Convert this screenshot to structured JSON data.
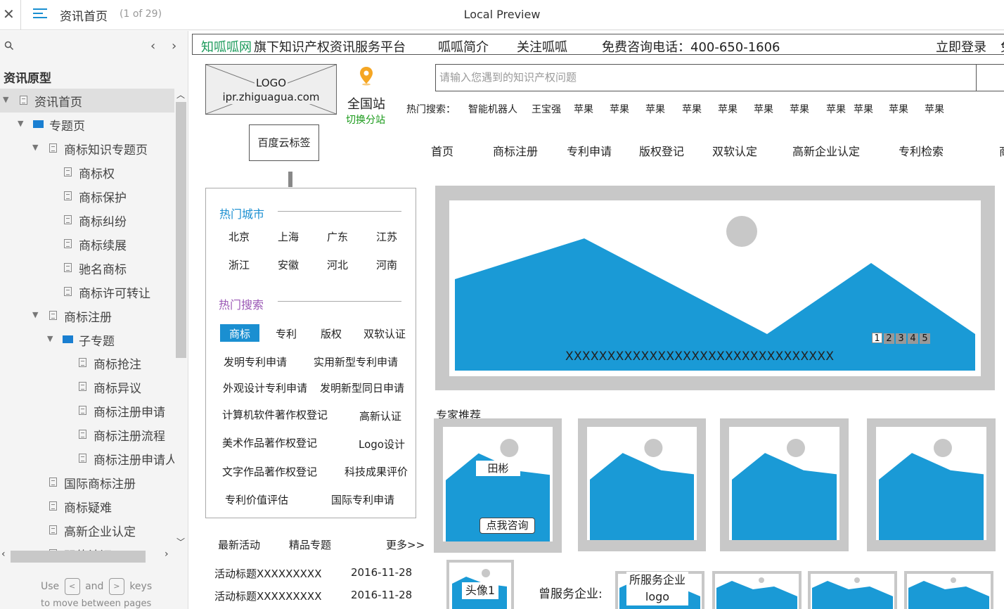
{
  "topbar": {
    "close_glyph": "✕",
    "page_title": "资讯首页",
    "page_count": "(1 of 29)",
    "preview_title": "Local Preview"
  },
  "sidebar": {
    "section_heading": "资讯原型",
    "items": [
      {
        "label": "资讯首页"
      },
      {
        "label": "专题页"
      },
      {
        "label": "商标知识专题页"
      },
      {
        "label": "商标权"
      },
      {
        "label": "商标保护"
      },
      {
        "label": "商标纠纷"
      },
      {
        "label": "商标续展"
      },
      {
        "label": "驰名商标"
      },
      {
        "label": "商标许可转让"
      },
      {
        "label": "商标注册"
      },
      {
        "label": "子专题"
      },
      {
        "label": "商标抢注"
      },
      {
        "label": "商标异议"
      },
      {
        "label": "商标注册申请"
      },
      {
        "label": "商标注册流程"
      },
      {
        "label": "商标注册申请人"
      },
      {
        "label": "国际商标注册"
      },
      {
        "label": "商标疑难"
      },
      {
        "label": "高新企业认定"
      },
      {
        "label": "双软认证"
      }
    ],
    "help": {
      "use": "Use",
      "and": "and",
      "keys": "keys",
      "prev_key": "<",
      "next_key": ">",
      "move_text": "to move between pages"
    }
  },
  "page": {
    "infobar": {
      "brand": "知呱呱网",
      "slogan": "旗下知识产权资讯服务平台",
      "about": "呱呱简介",
      "follow": "关注呱呱",
      "hotline": "免费咨询电话：400-650-1606",
      "login": "立即登录",
      "register_partial": "免"
    },
    "logo": {
      "line1": "LOGO",
      "line2": "ipr.zhiguagua.com"
    },
    "location": {
      "station": "全国站",
      "switch": "切换分站"
    },
    "baidu_tag": "百度云标签",
    "search": {
      "placeholder": "请输入您遇到的知识产权问题"
    },
    "hot_search": {
      "label": "热门搜索：",
      "items": [
        "智能机器人",
        "王宝强",
        "苹果",
        "苹果",
        "苹果",
        "苹果",
        "苹果",
        "苹果",
        "苹果",
        "苹果",
        "苹果",
        "苹果",
        "苹果"
      ]
    },
    "nav": [
      "首页",
      "商标注册",
      "专利申请",
      "版权登记",
      "双软认定",
      "高新企业认定",
      "专利检索",
      "商"
    ],
    "hot_cities": {
      "title": "热门城市",
      "cities": [
        "北京",
        "上海",
        "广东",
        "江苏",
        "浙江",
        "安徽",
        "河北",
        "河南"
      ]
    },
    "hot_searches": {
      "title": "热门搜索",
      "tags": [
        "商标",
        "专利",
        "版权",
        "双软认证"
      ],
      "links": [
        "发明专利申请",
        "实用新型专利申请",
        "外观设计专利申请",
        "发明新型同日申请",
        "计算机软件著作权登记",
        "高新认证",
        "美术作品著作权登记",
        "Logo设计",
        "文字作品著作权登记",
        "科技成果评价",
        "专利价值评估",
        "国际专利申请"
      ]
    },
    "banner": {
      "caption": "XXXXXXXXXXXXXXXXXXXXXXXXXXXXXXXX",
      "pages": [
        "1",
        "2",
        "3",
        "4",
        "5"
      ],
      "active_page": 1
    },
    "experts": {
      "title": "专家推荐",
      "first_name": "田彬",
      "consult_button": "点我咨询"
    },
    "activities": {
      "tab_latest": "最新活动",
      "tab_featured": "精品专题",
      "more": "更多>>",
      "rows": [
        {
          "title": "活动标题XXXXXXXXX",
          "date": "2016-11-28"
        },
        {
          "title": "活动标题XXXXXXXXX",
          "date": "2016-11-28"
        }
      ]
    },
    "avatar_label": "头像1",
    "served_label": "曾服务企业:",
    "served_logo_label": "所服务企业logo"
  },
  "colors": {
    "accent_blue": "#1a8fd1",
    "image_blue": "#1a9ad6",
    "placeholder_gray": "#c8c8c8",
    "city_title": "#1a8fd1",
    "search_title": "#9b59b6",
    "switch_green": "#1a9a1a",
    "pin_orange": "#f5a623"
  }
}
